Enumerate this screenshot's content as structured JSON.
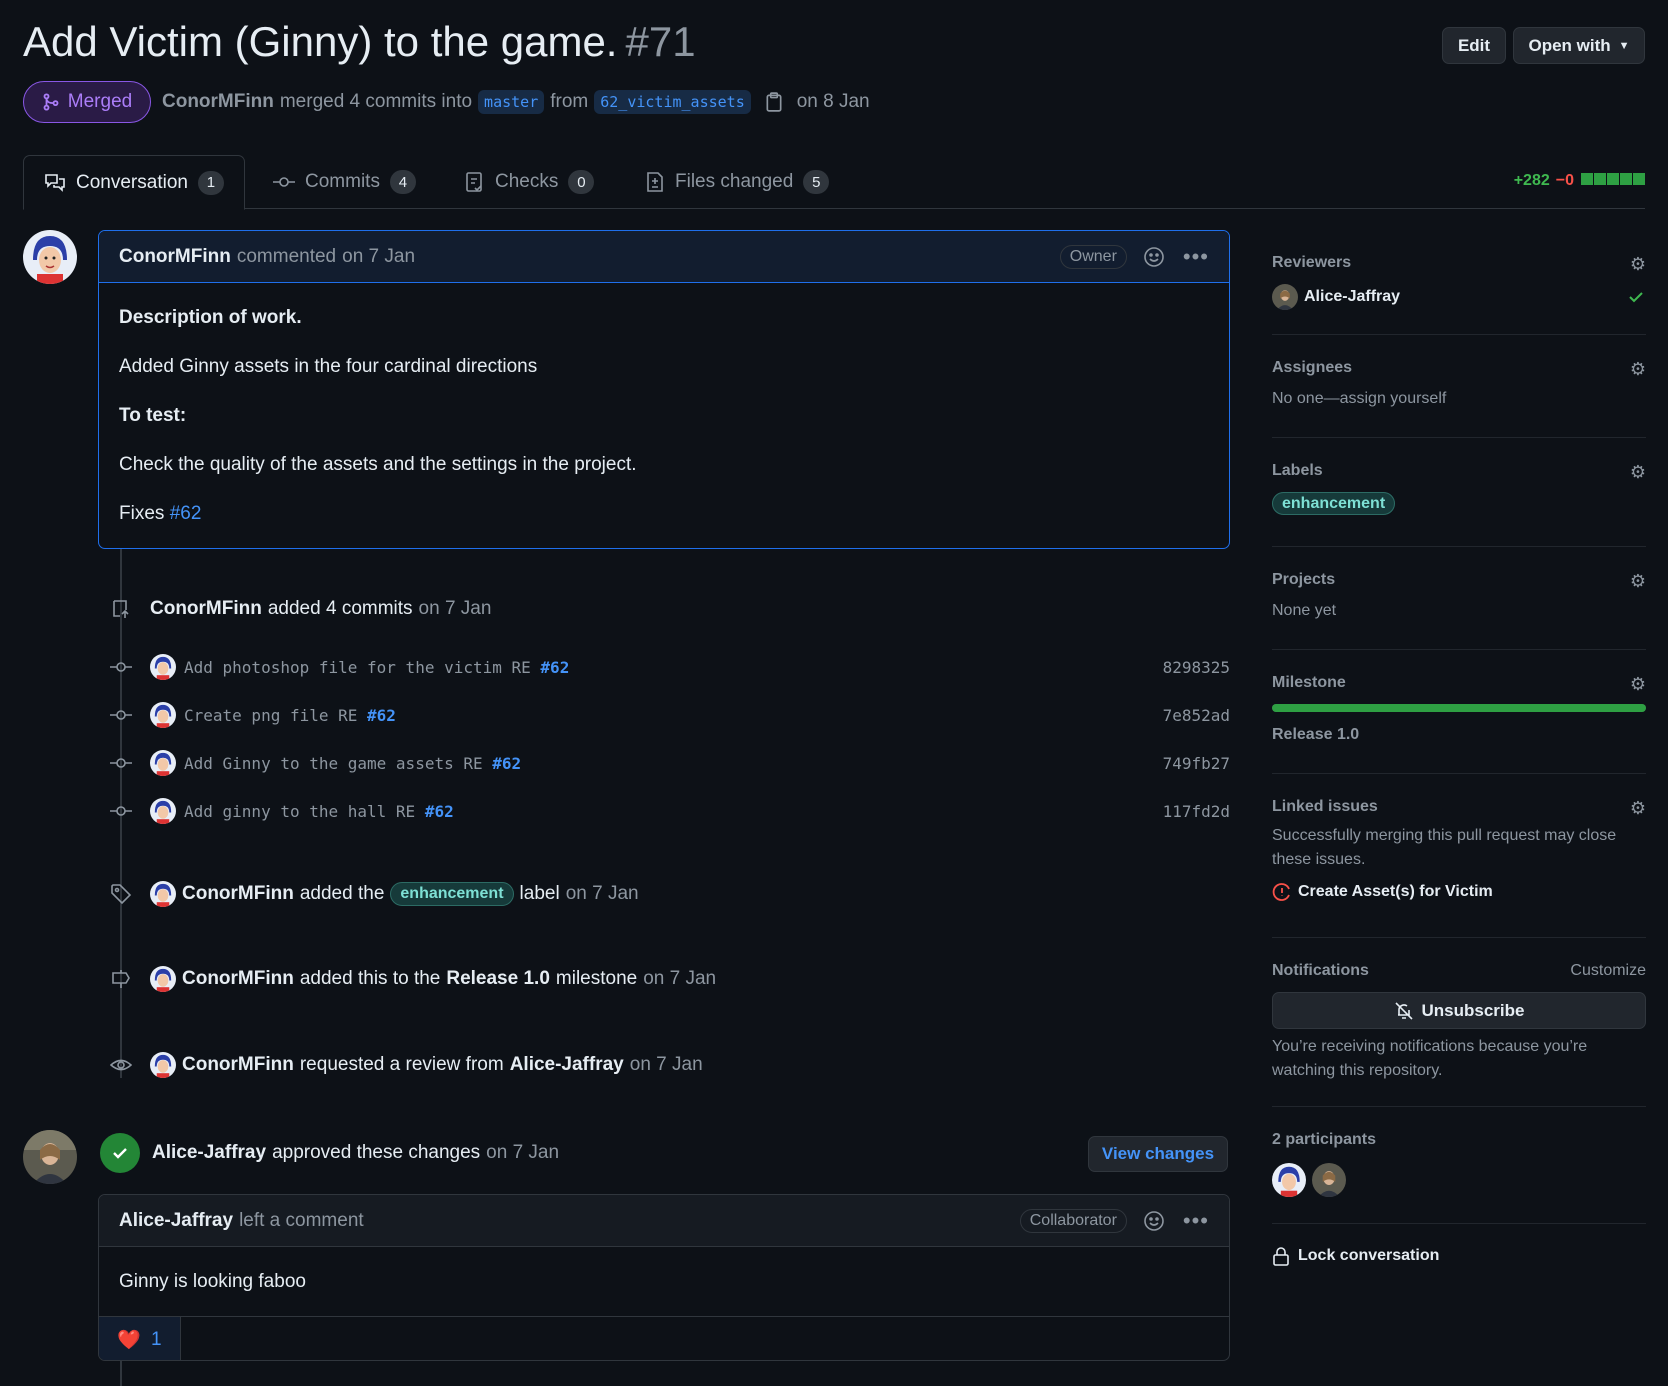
{
  "header": {
    "title": "Add Victim (Ginny) to the game.",
    "number": "#71",
    "edit_label": "Edit",
    "open_with_label": "Open with",
    "state": "Merged",
    "author": "ConorMFinn",
    "merged_text": "merged 4 commits into",
    "base_branch": "master",
    "from_text": "from",
    "head_branch": "62_victim_assets",
    "date_text": "on 8 Jan"
  },
  "tabs": [
    {
      "label": "Conversation",
      "count": "1"
    },
    {
      "label": "Commits",
      "count": "4"
    },
    {
      "label": "Checks",
      "count": "0"
    },
    {
      "label": "Files changed",
      "count": "5"
    }
  ],
  "diffstat": {
    "additions": "+282",
    "deletions": "−0",
    "blocks": 5
  },
  "comment1": {
    "author": "ConorMFinn",
    "action": "commented",
    "date": "on 7 Jan",
    "role": "Owner",
    "heading1": "Description of work.",
    "line1": "Added Ginny assets in the four cardinal directions",
    "heading2": "To test:",
    "line2": "Check the quality of the assets and the settings in the project.",
    "fixes_text": "Fixes",
    "fixes_link": "#62"
  },
  "commits_event": {
    "author": "ConorMFinn",
    "text": "added 4 commits",
    "date": "on 7 Jan"
  },
  "commits": [
    {
      "msg": "Add photoshop file for the victim RE",
      "ref": "#62",
      "sha": "8298325"
    },
    {
      "msg": "Create png file RE",
      "ref": "#62",
      "sha": "7e852ad"
    },
    {
      "msg": "Add Ginny to the game assets RE",
      "ref": "#62",
      "sha": "749fb27"
    },
    {
      "msg": "Add ginny to the hall RE",
      "ref": "#62",
      "sha": "117fd2d"
    }
  ],
  "label_event": {
    "author": "ConorMFinn",
    "text": "added the",
    "label": "enhancement",
    "suffix": "label",
    "date": "on 7 Jan"
  },
  "milestone_event": {
    "author": "ConorMFinn",
    "text": "added this to the",
    "milestone": "Release 1.0",
    "suffix": "milestone",
    "date": "on 7 Jan"
  },
  "review_request_event": {
    "author": "ConorMFinn",
    "text": "requested a review from",
    "reviewer": "Alice-Jaffray",
    "date": "on 7 Jan"
  },
  "approval_event": {
    "author": "Alice-Jaffray",
    "text": "approved these changes",
    "date": "on 7 Jan",
    "button": "View changes"
  },
  "comment2": {
    "author": "Alice-Jaffray",
    "action": "left a comment",
    "role": "Collaborator",
    "body": "Ginny is looking faboo",
    "reaction_emoji": "❤️",
    "reaction_count": "1"
  },
  "sidebar": {
    "reviewers_title": "Reviewers",
    "reviewer": "Alice-Jaffray",
    "assignees_title": "Assignees",
    "assignees_text": "No one—assign yourself",
    "labels_title": "Labels",
    "label": "enhancement",
    "projects_title": "Projects",
    "projects_text": "None yet",
    "milestone_title": "Milestone",
    "milestone_name": "Release 1.0",
    "milestone_progress": 1.0,
    "linked_title": "Linked issues",
    "linked_text": "Successfully merging this pull request may close these issues.",
    "linked_issue": "Create Asset(s) for Victim",
    "notifications_title": "Notifications",
    "customize": "Customize",
    "unsubscribe": "Unsubscribe",
    "notif_text": "You’re receiving notifications because you’re watching this repository.",
    "participants_title": "2 participants",
    "lock": "Lock conversation"
  },
  "colors": {
    "accent": "#4493f8",
    "merged": "#ab7df8",
    "success": "#2ea043",
    "danger": "#f85149"
  }
}
